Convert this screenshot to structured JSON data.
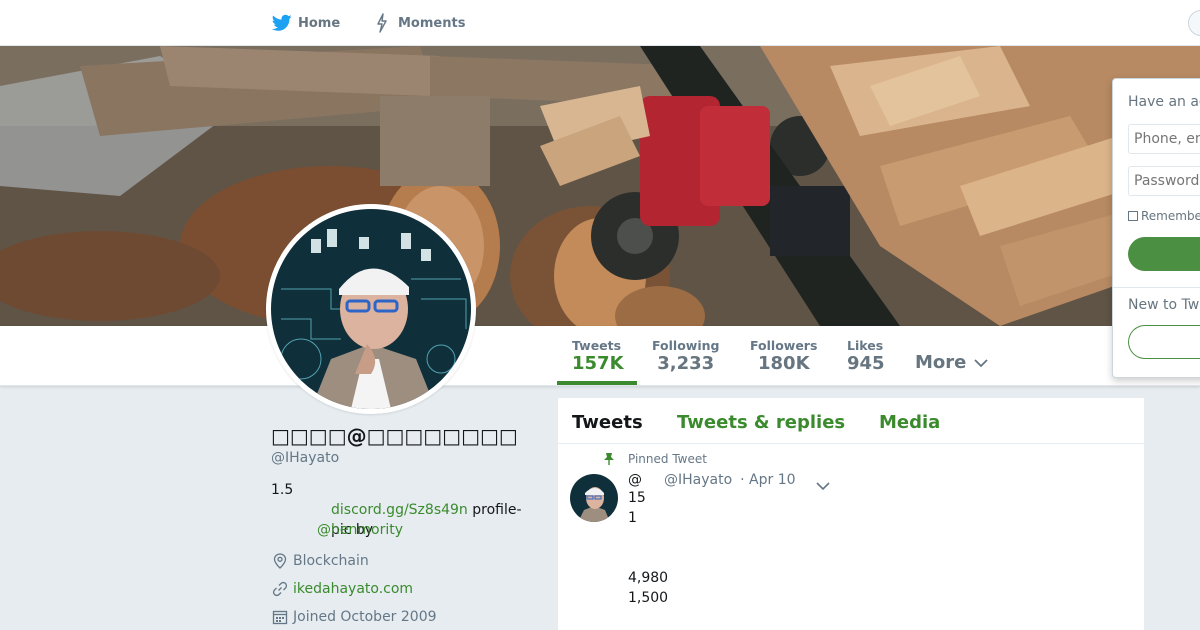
{
  "nav": {
    "home_label": "Home",
    "moments_label": "Moments"
  },
  "profile_nav": {
    "stats": [
      {
        "label": "Tweets",
        "value": "157K"
      },
      {
        "label": "Following",
        "value": "3,233"
      },
      {
        "label": "Followers",
        "value": "180K"
      },
      {
        "label": "Likes",
        "value": "945"
      }
    ],
    "more_label": "More"
  },
  "profile": {
    "name": "□□□□@□□□□□□□□",
    "handle": "@IHayato",
    "bio_line1": "1.5",
    "bio_link": "discord.gg/Sz8s49n",
    "bio_text": " profile-pic by ",
    "bio_mention": "@henmority",
    "location": "Blockchain",
    "website": "ikedahayato.com",
    "joined": "Joined October 2009"
  },
  "timeline": {
    "tabs": [
      "Tweets",
      "Tweets & replies",
      "Media"
    ],
    "pinned_label": "Pinned Tweet",
    "tweet": {
      "at": "@",
      "handle": "@IHayato",
      "date": "· Apr 10",
      "lines": [
        "15",
        "1",
        "4,980",
        "1,500"
      ]
    }
  },
  "login": {
    "title": "Have an account?",
    "phone_placeholder": "Phone, email or username",
    "password_placeholder": "Password",
    "remember_label": "Remember me",
    "new_label": "New to Twitter?"
  },
  "colors": {
    "accent": "#3b8b2e",
    "button_green": "#4b9042"
  },
  "icons": {
    "home": "twitter-bird-icon",
    "moments": "lightning-icon",
    "location": "map-pin-icon",
    "website": "link-icon",
    "joined": "calendar-icon",
    "pinned": "pin-icon"
  }
}
